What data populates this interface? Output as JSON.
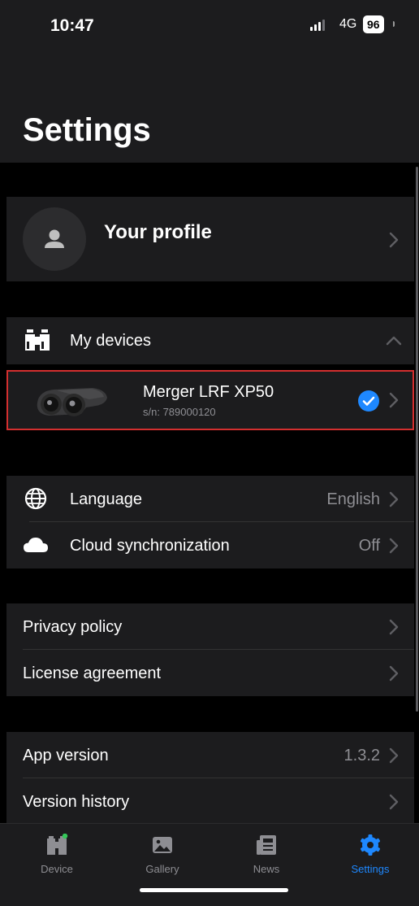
{
  "status_bar": {
    "time": "10:47",
    "network": "4G",
    "battery": "96"
  },
  "page": {
    "title": "Settings"
  },
  "profile": {
    "label": "Your profile"
  },
  "devices": {
    "section_label": "My devices",
    "items": [
      {
        "name": "Merger LRF XP50",
        "serial": "s/n: 789000120",
        "selected": true
      }
    ]
  },
  "general": {
    "language": {
      "label": "Language",
      "value": "English"
    },
    "cloud": {
      "label": "Cloud synchronization",
      "value": "Off"
    }
  },
  "legal": {
    "privacy": {
      "label": "Privacy policy"
    },
    "license": {
      "label": "License agreement"
    }
  },
  "about": {
    "app_version": {
      "label": "App version",
      "value": "1.3.2"
    },
    "version_history": {
      "label": "Version history"
    }
  },
  "tabbar": {
    "active": "settings",
    "accent": "#1e88ff",
    "tabs": [
      {
        "id": "device",
        "label": "Device"
      },
      {
        "id": "gallery",
        "label": "Gallery"
      },
      {
        "id": "news",
        "label": "News"
      },
      {
        "id": "settings",
        "label": "Settings"
      }
    ]
  },
  "colors": {
    "background": "#000000",
    "cell": "#1c1c1e",
    "secondary_text": "#8e8e93",
    "highlight_border": "#d32f2f",
    "status_dot": "#34c759"
  }
}
